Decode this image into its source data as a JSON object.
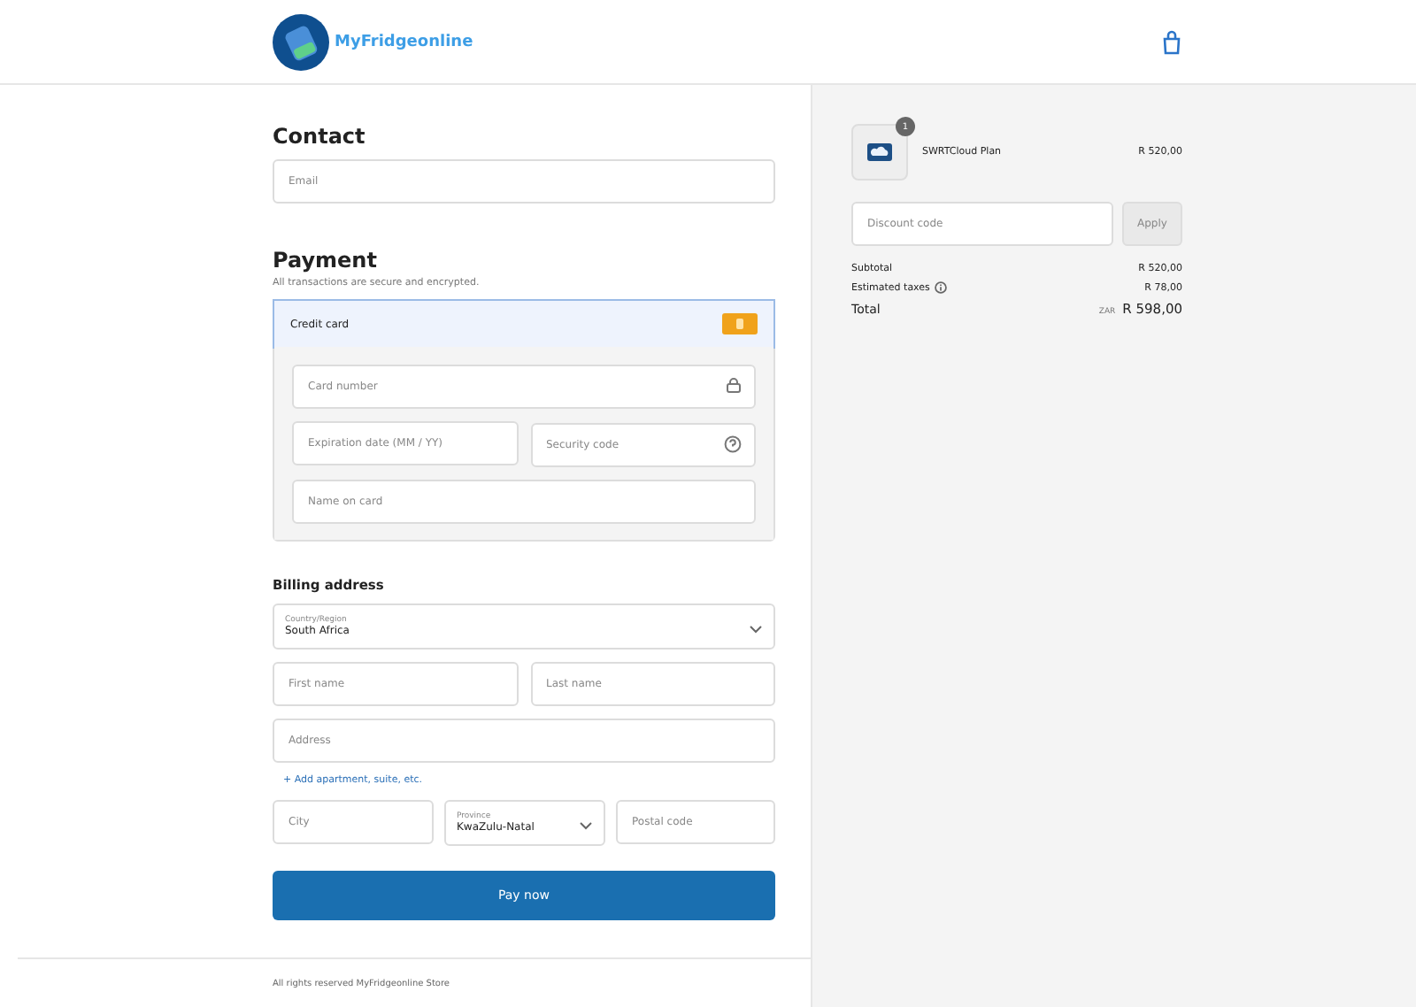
{
  "header": {
    "logo_text": "MyFridgeonline"
  },
  "contact": {
    "title": "Contact",
    "email": {
      "placeholder": "Email"
    }
  },
  "payment": {
    "title": "Payment",
    "note": "All transactions are secure and encrypted.",
    "method": {
      "label": "Credit card",
      "selected": true
    },
    "fields": {
      "card_number": {
        "placeholder": "Card number"
      },
      "expiry": {
        "placeholder": "Expiration date (MM / YY)"
      },
      "security": {
        "placeholder": "Security code"
      },
      "name": {
        "placeholder": "Name on card"
      }
    }
  },
  "billing": {
    "title": "Billing address",
    "country": {
      "label": "Country/Region",
      "value": "South Africa"
    },
    "first_name": {
      "placeholder": "First name"
    },
    "last_name": {
      "placeholder": "Last name"
    },
    "address": {
      "placeholder": "Address"
    },
    "add_link": "+ Add apartment, suite, etc.",
    "city": {
      "placeholder": "City"
    },
    "province": {
      "label": "Province",
      "value": "KwaZulu-Natal"
    },
    "postal": {
      "placeholder": "Postal code"
    }
  },
  "pay_button": "Pay now",
  "footer": "All rights reserved MyFridgeonline Store",
  "summary": {
    "item": {
      "name": "SWRTCloud Plan",
      "price": "R 520,00",
      "quantity": "1"
    },
    "discount": {
      "placeholder": "Discount code",
      "button": "Apply"
    },
    "lines": [
      {
        "label": "Subtotal",
        "value": "R 520,00",
        "info": false
      },
      {
        "label": "Estimated taxes",
        "value": "R 78,00",
        "info": true
      }
    ],
    "total": {
      "label": "Total",
      "currency": "ZAR",
      "value": "R 598,00"
    }
  }
}
